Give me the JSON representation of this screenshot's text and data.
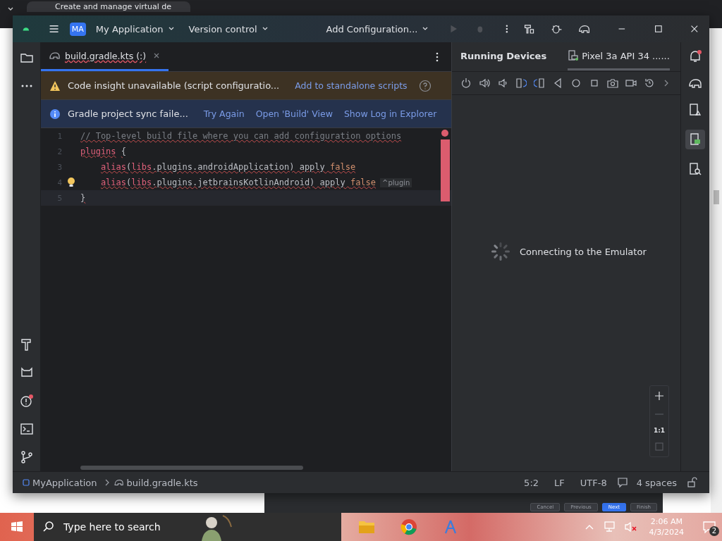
{
  "browser": {
    "tab_title": "Create and manage virtual de"
  },
  "title_bar": {
    "project_badge": "MA",
    "project": "My Application",
    "vcs": "Version control",
    "run_config": "Add Configuration..."
  },
  "editor_tabs": [
    {
      "label": "build.gradle.kts (:)",
      "selected": true,
      "error": true
    }
  ],
  "banners": [
    {
      "kind": "warning",
      "text": "Code insight unavailable (script configuratio...",
      "links": [
        "Add to standalone scripts"
      ],
      "help": true
    },
    {
      "kind": "info",
      "text": "Gradle project sync faile...",
      "links": [
        "Try Again",
        "Open 'Build' View",
        "Show Log in Explorer"
      ],
      "help": false
    }
  ],
  "code_lines": [
    {
      "number": "1",
      "current": false,
      "bulb": false,
      "indented": false,
      "tokens": [
        {
          "kind": "comment",
          "text": "// Top-level build file where you can add configuration options"
        }
      ]
    },
    {
      "number": "2",
      "current": false,
      "bulb": false,
      "indented": false,
      "tokens": [
        {
          "kind": "unresolved",
          "text": "plugins"
        },
        {
          "kind": "brace",
          "text": "{"
        }
      ]
    },
    {
      "number": "3",
      "current": false,
      "bulb": false,
      "indented": true,
      "tokens": [
        {
          "kind": "unresolved",
          "text": "alias"
        },
        {
          "kind": "plain",
          "text": "("
        },
        {
          "kind": "unresolved",
          "text": "libs"
        },
        {
          "kind": "plain",
          "text": ".plugins.androidApplication) apply "
        },
        {
          "kind": "keyword",
          "text": "false"
        }
      ]
    },
    {
      "number": "4",
      "current": false,
      "bulb": true,
      "indented": true,
      "tokens": [
        {
          "kind": "unresolved",
          "text": "alias"
        },
        {
          "kind": "plain",
          "text": "("
        },
        {
          "kind": "unresolved",
          "text": "libs"
        },
        {
          "kind": "plain",
          "text": ".plugins.jetbrainsKotlinAndroid) apply "
        },
        {
          "kind": "keyword",
          "text": "false"
        },
        {
          "kind": "hint",
          "text": "^plugin"
        }
      ]
    },
    {
      "number": "5",
      "current": true,
      "bulb": false,
      "indented": false,
      "tokens": [
        {
          "kind": "brace",
          "text": "}"
        }
      ]
    }
  ],
  "device_panel": {
    "tabs": [
      {
        "label": "Running Devices",
        "selected": false
      },
      {
        "label": "Pixel 3a API 34 ......",
        "selected": true
      }
    ],
    "status": "Connecting to the Emulator",
    "zoom_reset": "1:1"
  },
  "status_bar": {
    "breadcrumbs": [
      "MyApplication",
      "build.gradle.kts"
    ],
    "items": [
      "5:2",
      "LF",
      "UTF-8",
      "4 spaces"
    ]
  },
  "wizard_buttons": [
    {
      "label": "Cancel",
      "selected": false
    },
    {
      "label": "Previous",
      "selected": false
    },
    {
      "label": "Next",
      "selected": true
    },
    {
      "label": "Finish",
      "selected": false
    }
  ],
  "taskbar": {
    "search_placeholder": "Type here to search",
    "time": "2:06 AM",
    "date": "4/3/2024",
    "notifications": "2"
  }
}
